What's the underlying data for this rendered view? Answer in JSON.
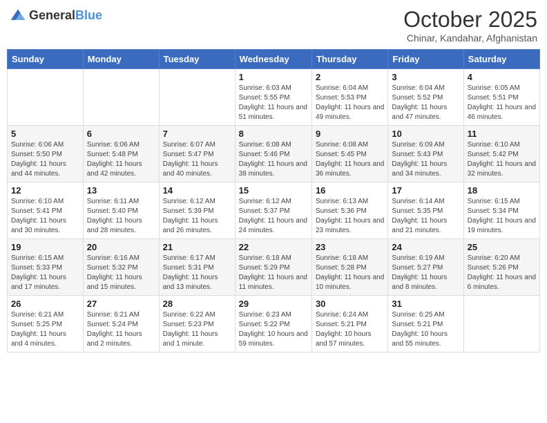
{
  "header": {
    "logo_general": "General",
    "logo_blue": "Blue",
    "month": "October 2025",
    "location": "Chinar, Kandahar, Afghanistan"
  },
  "weekdays": [
    "Sunday",
    "Monday",
    "Tuesday",
    "Wednesday",
    "Thursday",
    "Friday",
    "Saturday"
  ],
  "weeks": [
    [
      {
        "day": "",
        "info": ""
      },
      {
        "day": "",
        "info": ""
      },
      {
        "day": "",
        "info": ""
      },
      {
        "day": "1",
        "info": "Sunrise: 6:03 AM\nSunset: 5:55 PM\nDaylight: 11 hours and 51 minutes."
      },
      {
        "day": "2",
        "info": "Sunrise: 6:04 AM\nSunset: 5:53 PM\nDaylight: 11 hours and 49 minutes."
      },
      {
        "day": "3",
        "info": "Sunrise: 6:04 AM\nSunset: 5:52 PM\nDaylight: 11 hours and 47 minutes."
      },
      {
        "day": "4",
        "info": "Sunrise: 6:05 AM\nSunset: 5:51 PM\nDaylight: 11 hours and 46 minutes."
      }
    ],
    [
      {
        "day": "5",
        "info": "Sunrise: 6:06 AM\nSunset: 5:50 PM\nDaylight: 11 hours and 44 minutes."
      },
      {
        "day": "6",
        "info": "Sunrise: 6:06 AM\nSunset: 5:48 PM\nDaylight: 11 hours and 42 minutes."
      },
      {
        "day": "7",
        "info": "Sunrise: 6:07 AM\nSunset: 5:47 PM\nDaylight: 11 hours and 40 minutes."
      },
      {
        "day": "8",
        "info": "Sunrise: 6:08 AM\nSunset: 5:46 PM\nDaylight: 11 hours and 38 minutes."
      },
      {
        "day": "9",
        "info": "Sunrise: 6:08 AM\nSunset: 5:45 PM\nDaylight: 11 hours and 36 minutes."
      },
      {
        "day": "10",
        "info": "Sunrise: 6:09 AM\nSunset: 5:43 PM\nDaylight: 11 hours and 34 minutes."
      },
      {
        "day": "11",
        "info": "Sunrise: 6:10 AM\nSunset: 5:42 PM\nDaylight: 11 hours and 32 minutes."
      }
    ],
    [
      {
        "day": "12",
        "info": "Sunrise: 6:10 AM\nSunset: 5:41 PM\nDaylight: 11 hours and 30 minutes."
      },
      {
        "day": "13",
        "info": "Sunrise: 6:11 AM\nSunset: 5:40 PM\nDaylight: 11 hours and 28 minutes."
      },
      {
        "day": "14",
        "info": "Sunrise: 6:12 AM\nSunset: 5:39 PM\nDaylight: 11 hours and 26 minutes."
      },
      {
        "day": "15",
        "info": "Sunrise: 6:12 AM\nSunset: 5:37 PM\nDaylight: 11 hours and 24 minutes."
      },
      {
        "day": "16",
        "info": "Sunrise: 6:13 AM\nSunset: 5:36 PM\nDaylight: 11 hours and 23 minutes."
      },
      {
        "day": "17",
        "info": "Sunrise: 6:14 AM\nSunset: 5:35 PM\nDaylight: 11 hours and 21 minutes."
      },
      {
        "day": "18",
        "info": "Sunrise: 6:15 AM\nSunset: 5:34 PM\nDaylight: 11 hours and 19 minutes."
      }
    ],
    [
      {
        "day": "19",
        "info": "Sunrise: 6:15 AM\nSunset: 5:33 PM\nDaylight: 11 hours and 17 minutes."
      },
      {
        "day": "20",
        "info": "Sunrise: 6:16 AM\nSunset: 5:32 PM\nDaylight: 11 hours and 15 minutes."
      },
      {
        "day": "21",
        "info": "Sunrise: 6:17 AM\nSunset: 5:31 PM\nDaylight: 11 hours and 13 minutes."
      },
      {
        "day": "22",
        "info": "Sunrise: 6:18 AM\nSunset: 5:29 PM\nDaylight: 11 hours and 11 minutes."
      },
      {
        "day": "23",
        "info": "Sunrise: 6:18 AM\nSunset: 5:28 PM\nDaylight: 11 hours and 10 minutes."
      },
      {
        "day": "24",
        "info": "Sunrise: 6:19 AM\nSunset: 5:27 PM\nDaylight: 11 hours and 8 minutes."
      },
      {
        "day": "25",
        "info": "Sunrise: 6:20 AM\nSunset: 5:26 PM\nDaylight: 11 hours and 6 minutes."
      }
    ],
    [
      {
        "day": "26",
        "info": "Sunrise: 6:21 AM\nSunset: 5:25 PM\nDaylight: 11 hours and 4 minutes."
      },
      {
        "day": "27",
        "info": "Sunrise: 6:21 AM\nSunset: 5:24 PM\nDaylight: 11 hours and 2 minutes."
      },
      {
        "day": "28",
        "info": "Sunrise: 6:22 AM\nSunset: 5:23 PM\nDaylight: 11 hours and 1 minute."
      },
      {
        "day": "29",
        "info": "Sunrise: 6:23 AM\nSunset: 5:22 PM\nDaylight: 10 hours and 59 minutes."
      },
      {
        "day": "30",
        "info": "Sunrise: 6:24 AM\nSunset: 5:21 PM\nDaylight: 10 hours and 57 minutes."
      },
      {
        "day": "31",
        "info": "Sunrise: 6:25 AM\nSunset: 5:21 PM\nDaylight: 10 hours and 55 minutes."
      },
      {
        "day": "",
        "info": ""
      }
    ]
  ]
}
